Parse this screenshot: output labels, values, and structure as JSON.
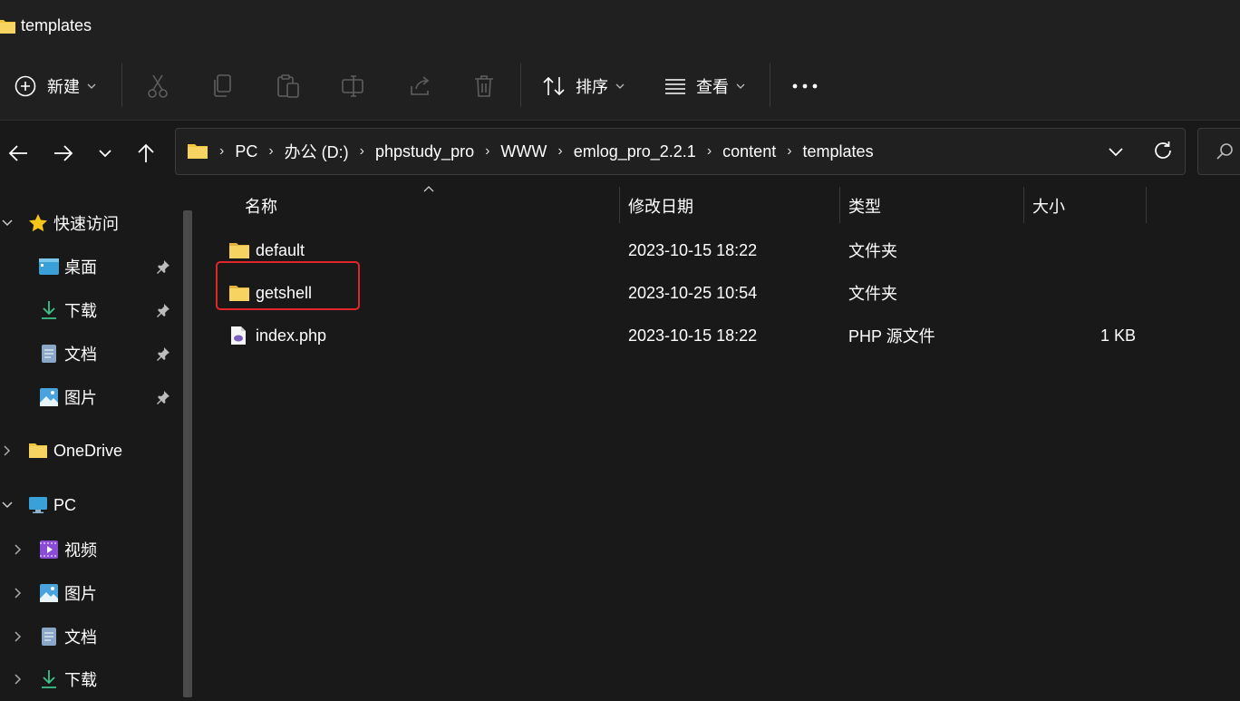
{
  "window": {
    "title": "templates"
  },
  "toolbar": {
    "new_label": "新建",
    "sort_label": "排序",
    "view_label": "查看",
    "more_glyph": "•••"
  },
  "address": {
    "crumbs": [
      "PC",
      "办公 (D:)",
      "phpstudy_pro",
      "WWW",
      "emlog_pro_2.2.1",
      "content",
      "templates"
    ],
    "separator": "›"
  },
  "sidebar": {
    "quick_access": "快速访问",
    "quick_items": [
      "桌面",
      "下载",
      "文档",
      "图片"
    ],
    "onedrive": "OneDrive",
    "pc": "PC",
    "pc_items": [
      "视频",
      "图片",
      "文档",
      "下载"
    ]
  },
  "columns": {
    "name": "名称",
    "modified": "修改日期",
    "type": "类型",
    "size": "大小"
  },
  "files": [
    {
      "name": "default",
      "modified": "2023-10-15 18:22",
      "type": "文件夹",
      "size": "",
      "icon": "folder-icon"
    },
    {
      "name": "getshell",
      "modified": "2023-10-25 10:54",
      "type": "文件夹",
      "size": "",
      "icon": "folder-icon"
    },
    {
      "name": "index.php",
      "modified": "2023-10-15 18:22",
      "type": "PHP 源文件",
      "size": "1 KB",
      "icon": "php-file-icon"
    }
  ],
  "colors": {
    "background": "#191919",
    "chrome": "#202020",
    "folder": "#f3c53c",
    "highlight": "#e0262a",
    "star": "#f5c518"
  }
}
